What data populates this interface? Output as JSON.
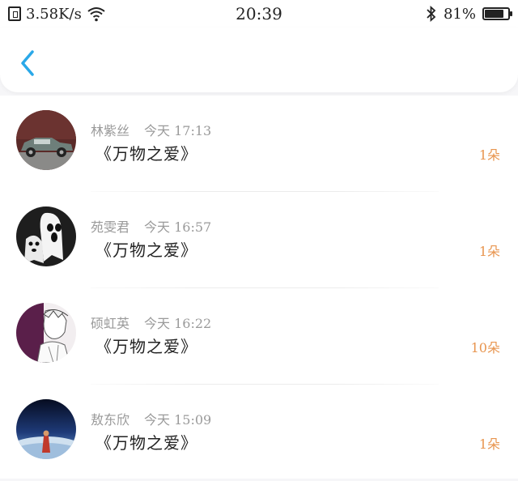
{
  "status_bar": {
    "speed": "3.58K/s",
    "time": "20:39",
    "battery_percent": "81%",
    "battery_level": 0.81
  },
  "nav": {
    "back_icon": "chevron-left-icon",
    "accent_color": "#2aa8e8"
  },
  "gift_list": [
    {
      "name": "林紫丝",
      "time": "今天 17:13",
      "title": "《万物之爱》",
      "count": "1朵",
      "avatar_icon": "vintage-car-avatar"
    },
    {
      "name": "苑雯君",
      "time": "今天 16:57",
      "title": "《万物之爱》",
      "count": "1朵",
      "avatar_icon": "cartoon-ghost-avatar"
    },
    {
      "name": "硕虹英",
      "time": "今天 16:22",
      "title": "《万物之爱》",
      "count": "10朵",
      "avatar_icon": "anime-sketch-avatar"
    },
    {
      "name": "敖东欣",
      "time": "今天 15:09",
      "title": "《万物之爱》",
      "count": "1朵",
      "avatar_icon": "earth-monk-avatar"
    }
  ],
  "colors": {
    "count": "#e8954f",
    "meta": "#9a9a9a",
    "title": "#222222"
  }
}
